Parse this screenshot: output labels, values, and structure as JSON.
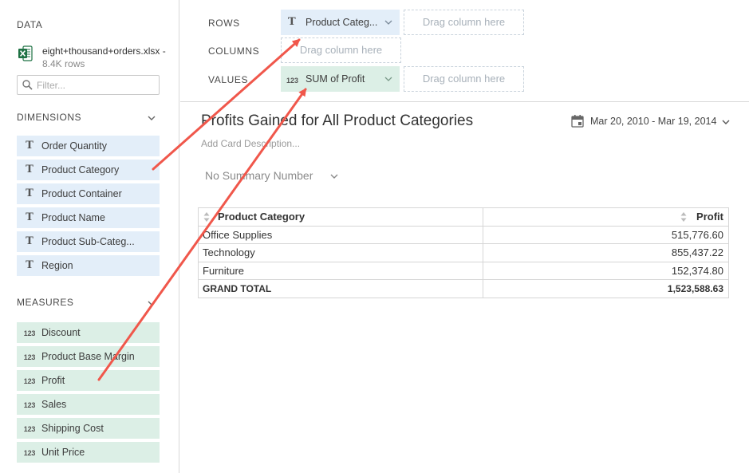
{
  "sidebar": {
    "data_title": "DATA",
    "file_name": "eight+thousand+orders.xlsx - ",
    "file_rows": "8.4K rows",
    "filter_placeholder": "Filter...",
    "dimensions_title": "DIMENSIONS",
    "dimensions": [
      {
        "icon": "T",
        "label": "Order Quantity"
      },
      {
        "icon": "T",
        "label": "Product Category"
      },
      {
        "icon": "T",
        "label": "Product Container"
      },
      {
        "icon": "T",
        "label": "Product Name"
      },
      {
        "icon": "T",
        "label": "Product Sub-Categ..."
      },
      {
        "icon": "T",
        "label": "Region"
      }
    ],
    "measures_title": "MEASURES",
    "measures": [
      {
        "icon": "123",
        "label": "Discount"
      },
      {
        "icon": "123",
        "label": "Product Base Margin"
      },
      {
        "icon": "123",
        "label": "Profit"
      },
      {
        "icon": "123",
        "label": "Sales"
      },
      {
        "icon": "123",
        "label": "Shipping Cost"
      },
      {
        "icon": "123",
        "label": "Unit Price"
      }
    ]
  },
  "shelf": {
    "rows_label": "ROWS",
    "columns_label": "COLUMNS",
    "values_label": "VALUES",
    "rows_pill": {
      "icon": "T",
      "label": "Product Categ..."
    },
    "values_pill": {
      "icon": "123",
      "label": "SUM of Profit"
    },
    "drop_text": "Drag column here"
  },
  "card": {
    "title": "Profits Gained for All Product Categories",
    "description_placeholder": "Add Card Description...",
    "date_range": "Mar 20, 2010 - Mar 19, 2014",
    "summary": "No Summary Number"
  },
  "table": {
    "headers": [
      "Product Category",
      "Profit"
    ],
    "rows": [
      [
        "Office Supplies",
        "515,776.60"
      ],
      [
        "Technology",
        "855,437.22"
      ],
      [
        "Furniture",
        "152,374.80"
      ]
    ],
    "total": [
      "GRAND TOTAL",
      "1,523,588.63"
    ]
  },
  "colors": {
    "dimension_bg": "#e3eef9",
    "measure_bg": "#dcefe6",
    "annotation_arrow": "#f0574b",
    "excel_green": "#1f7244"
  }
}
